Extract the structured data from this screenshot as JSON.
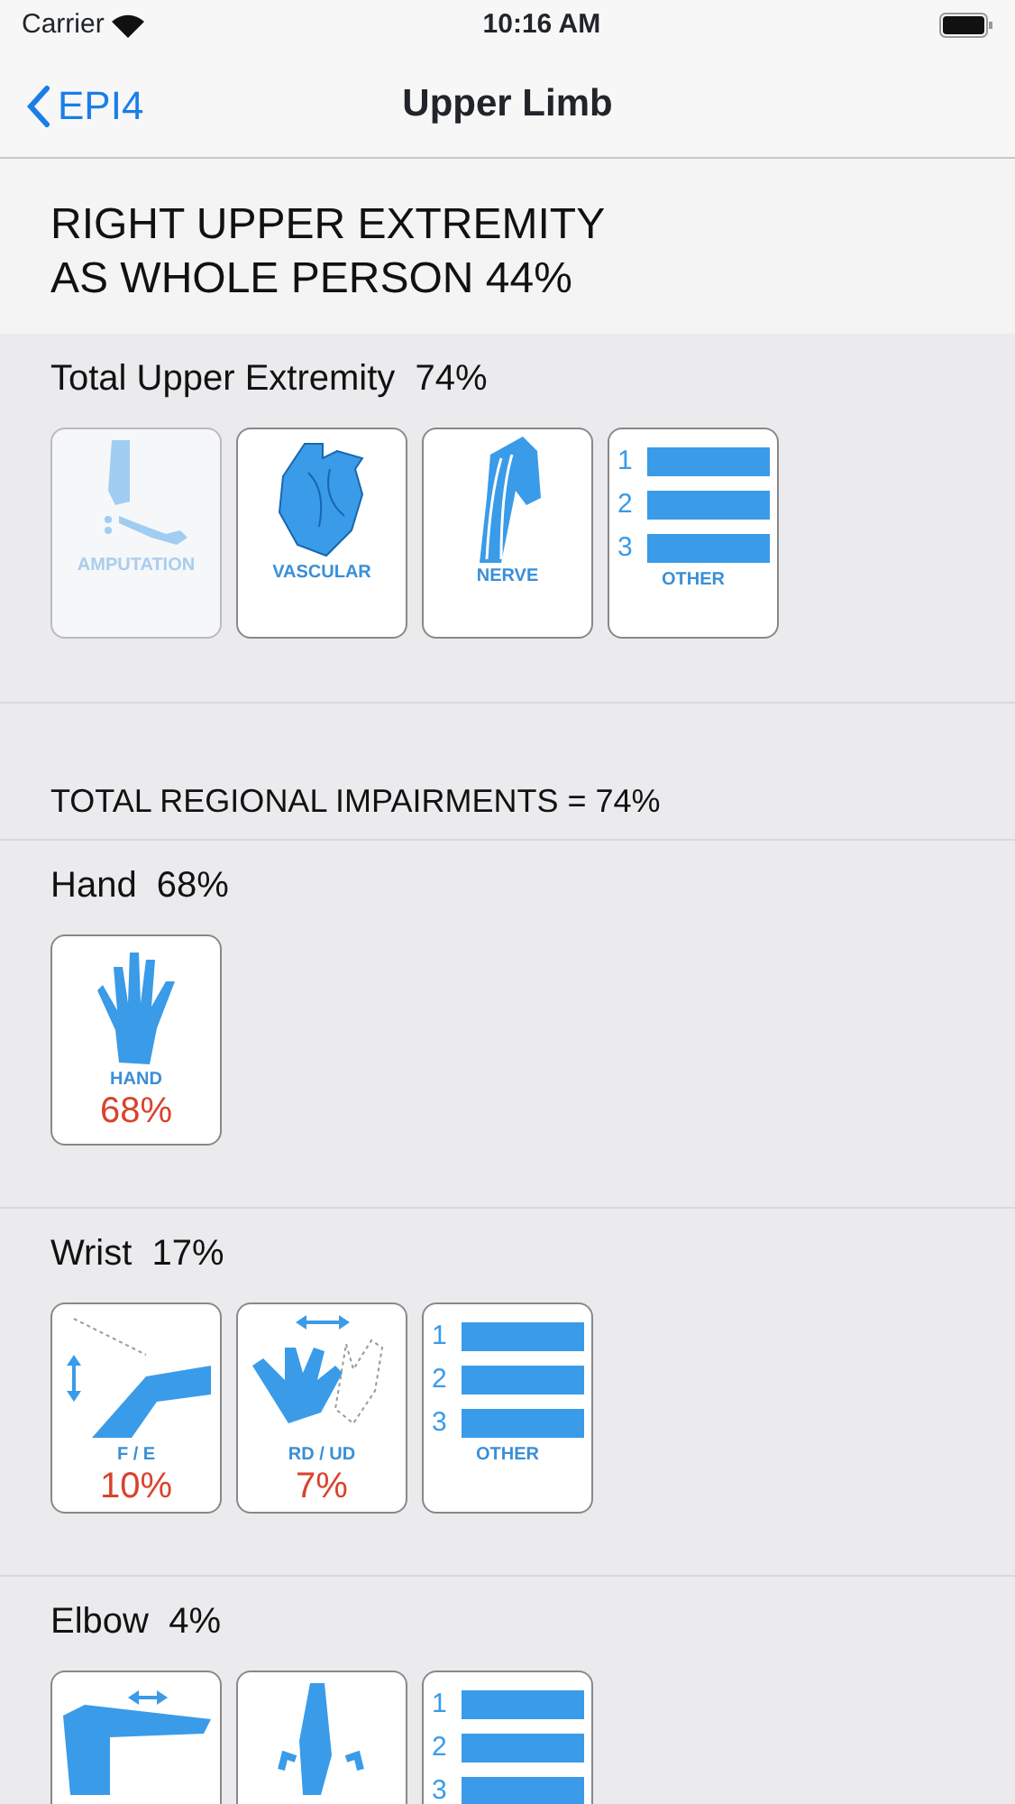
{
  "status_bar": {
    "carrier": "Carrier",
    "time": "10:16 AM"
  },
  "nav": {
    "back": "EPI4",
    "title": "Upper Limb"
  },
  "header": {
    "lines": [
      "RIGHT UPPER EXTREMITY",
      "AS WHOLE PERSON 44%"
    ]
  },
  "sections": [
    {
      "kind": "group",
      "title": "Total Upper Extremity  74%",
      "tiles": [
        {
          "kind": "amputation",
          "label": "AMPUTATION",
          "disabled": true
        },
        {
          "kind": "vascular",
          "label": "VASCULAR",
          "disabled": false
        },
        {
          "kind": "nerve",
          "label": "NERVE",
          "disabled": false
        },
        {
          "kind": "other",
          "label": "OTHER",
          "digits": [
            "1",
            "2",
            "3"
          ],
          "disabled": false
        }
      ]
    },
    {
      "kind": "band",
      "title": "TOTAL REGIONAL IMPAIRMENTS = 74%"
    },
    {
      "kind": "group",
      "title": "Hand  68%",
      "tiles": [
        {
          "kind": "hand",
          "label": "HAND",
          "value": "68%",
          "disabled": false
        }
      ]
    },
    {
      "kind": "group",
      "title": "Wrist  17%",
      "tiles": [
        {
          "kind": "wrist_fe",
          "label": "F / E",
          "value": "10%",
          "disabled": false
        },
        {
          "kind": "wrist_rdud",
          "label": "RD / UD",
          "value": "7%",
          "disabled": false
        },
        {
          "kind": "other",
          "label": "OTHER",
          "digits": [
            "1",
            "2",
            "3"
          ],
          "disabled": false
        }
      ]
    },
    {
      "kind": "group",
      "title": "Elbow  4%",
      "tiles": [
        {
          "kind": "elbow_fe",
          "disabled": false
        },
        {
          "kind": "elbow_ps",
          "disabled": false
        },
        {
          "kind": "other",
          "digits": [
            "1",
            "2",
            "3"
          ],
          "disabled": false
        }
      ]
    }
  ]
}
